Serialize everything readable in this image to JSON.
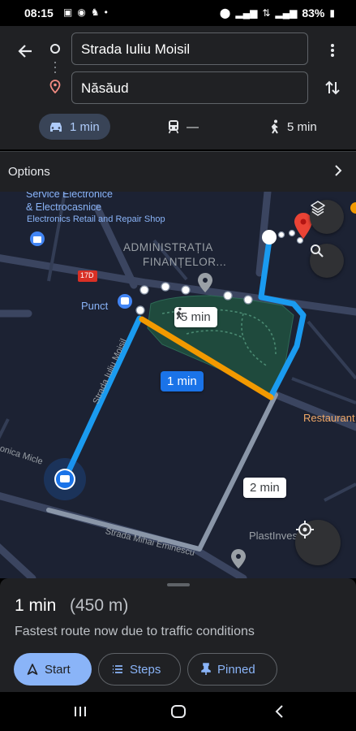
{
  "status_bar": {
    "time": "08:15",
    "battery": "83%"
  },
  "route": {
    "from": "Strada Iuliu Moisil",
    "to": "Năsăud"
  },
  "modes": [
    {
      "name": "drive",
      "label": "1 min",
      "icon": "car-icon"
    },
    {
      "name": "transit",
      "label": "—",
      "icon": "train-icon"
    },
    {
      "name": "walk",
      "label": "5 min",
      "icon": "walk-icon"
    }
  ],
  "options": {
    "label": "Options"
  },
  "map": {
    "labels": {
      "service1": "Service Electronice",
      "service2": "& Electrocasnice",
      "service3": "Electronics Retail and Repair Shop",
      "admin1": "ADMINISTRAȚIA",
      "admin2": "FINANȚELOR...",
      "punct": "Punct",
      "restaurant": "Restaurant",
      "plastinvest": "PlastInvest F",
      "road_number": "17D"
    },
    "streets": {
      "moisil": "Strada Iuliu Moisil",
      "mihai": "Strada Mihai Eminescu",
      "left": "onica Micle"
    },
    "callouts": {
      "walk": "5 min",
      "drive": "1 min",
      "alt": "2 min"
    },
    "colors": {
      "route_blue": "#1a9bf0",
      "traffic_orange": "#f29900",
      "alt_route": "#8a96a8",
      "park": "#1f4a3d"
    }
  },
  "sheet": {
    "time": "1 min",
    "distance": "(450 m)",
    "description": "Fastest route now due to traffic conditions",
    "buttons": {
      "start": "Start",
      "steps": "Steps",
      "pinned": "Pinned"
    }
  }
}
